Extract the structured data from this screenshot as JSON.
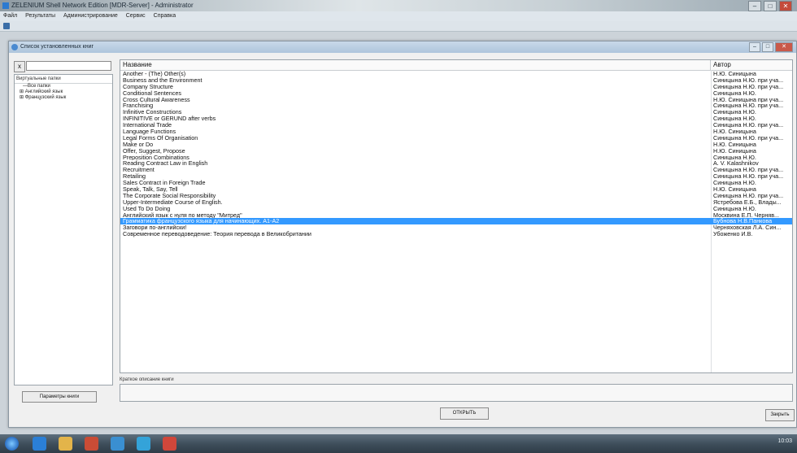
{
  "app_title": "ZELENIUM Shell Network Edition [MDR-Server] - Administrator",
  "menu": [
    "Файл",
    "Результаты",
    "Администрирование",
    "Сервис",
    "Справка"
  ],
  "window_title": "Список установленных книг",
  "search": {
    "button": "x",
    "value": ""
  },
  "tree": {
    "header": "Виртуальные папки",
    "items": [
      {
        "label": "Все папки",
        "level": 2
      },
      {
        "label": "Английский язык",
        "level": 1
      },
      {
        "label": "Французский язык",
        "level": 1
      }
    ]
  },
  "left_button": "Параметры книги",
  "table": {
    "headers": {
      "name": "Название",
      "author": "Автор"
    },
    "rows": [
      {
        "name": "Another - (The) Other(s)",
        "author": "Н.Ю. Синицына"
      },
      {
        "name": "Business and the Environment",
        "author": "Синицына Н.Ю. при уча..."
      },
      {
        "name": "Company Structure",
        "author": "Синицына Н.Ю. при уча..."
      },
      {
        "name": "Conditional Sentences",
        "author": "Синицына Н.Ю."
      },
      {
        "name": "Cross Cultural Awareness",
        "author": "Н.Ю. Синицына при уча..."
      },
      {
        "name": "Franchising",
        "author": "Синицына Н.Ю. при уча..."
      },
      {
        "name": "Infinitive Constructions",
        "author": "Синицына Н.Ю."
      },
      {
        "name": "INFINITIVE or GERUND after verbs",
        "author": "Синицына Н.Ю."
      },
      {
        "name": "International Trade",
        "author": "Синицына Н.Ю. при уча..."
      },
      {
        "name": "Language Functions",
        "author": "Н.Ю. Синицына"
      },
      {
        "name": "Legal Forms Of Organisation",
        "author": "Синицына Н.Ю. при уча..."
      },
      {
        "name": "Make or Do",
        "author": "Н.Ю. Синицына"
      },
      {
        "name": "Offer, Suggest, Propose",
        "author": "Н.Ю. Синицына"
      },
      {
        "name": "Preposition Combinations",
        "author": "Синицына Н.Ю."
      },
      {
        "name": "Reading Contract Law in English",
        "author": "A. V. Kalashnikov"
      },
      {
        "name": "Recruitment",
        "author": "Синицына Н.Ю. при уча..."
      },
      {
        "name": "Retailing",
        "author": "Синицына Н.Ю. при уча..."
      },
      {
        "name": "Sales Contract in Foreign Trade",
        "author": "Синицына Н.Ю."
      },
      {
        "name": "Speak, Talk, Say, Tell",
        "author": "Н.Ю. Синицына"
      },
      {
        "name": "The Corporate Social Responsibility",
        "author": "Синицына Н.Ю. при уча..."
      },
      {
        "name": "Upper-Intermediate Course of English.",
        "author": "Ястребова Е.Б., Влады..."
      },
      {
        "name": "Used To Do Doing",
        "author": "Синицына Н.Ю."
      },
      {
        "name": "Английский язык с нуля по методу \"Митред\"",
        "author": "Москвина Е.П. Черняв..."
      },
      {
        "name": "Грамматика французского языка для начинающих. A1-A2",
        "author": "Бубнова Н.В.Панкова",
        "selected": true
      },
      {
        "name": "Заговори по-английски!",
        "author": "Черняховская Л.А. Син..."
      },
      {
        "name": "Современное переводоведение: Теория перевода в Великобритании",
        "author": "Убоженко И.В."
      }
    ]
  },
  "description_label": "Краткое описание книги",
  "description_value": "",
  "open_button": "ОТКРЫТЬ",
  "close_button": "Закрыть",
  "tray_time": "10:03",
  "colors": {
    "selection": "#3399ff",
    "title_bar": "#aec5dc"
  }
}
